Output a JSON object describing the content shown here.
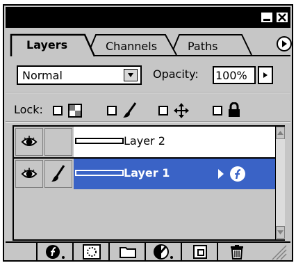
{
  "tabs": [
    {
      "label": "Layers",
      "active": true
    },
    {
      "label": "Channels",
      "active": false
    },
    {
      "label": "Paths",
      "active": false
    }
  ],
  "blend_mode": {
    "selected": "Normal"
  },
  "opacity": {
    "label": "Opacity:",
    "value": "100%"
  },
  "lock": {
    "label": "Lock:",
    "options": [
      {
        "icon": "transparency-icon",
        "checked": false
      },
      {
        "icon": "brush-icon",
        "checked": false
      },
      {
        "icon": "move-icon",
        "checked": false
      },
      {
        "icon": "lock-icon",
        "checked": false
      }
    ]
  },
  "layers": [
    {
      "name": "Layer 2",
      "visible": true,
      "selected": false,
      "has_brush": false
    },
    {
      "name": "Layer 1",
      "visible": true,
      "selected": true,
      "has_brush": true,
      "effects": true
    }
  ],
  "toolbar": {
    "buttons": [
      {
        "icon": "layer-style-icon"
      },
      {
        "icon": "layer-mask-icon"
      },
      {
        "icon": "new-set-icon"
      },
      {
        "icon": "adjustment-layer-icon"
      },
      {
        "icon": "new-layer-icon"
      },
      {
        "icon": "trash-icon"
      }
    ]
  },
  "colors": {
    "selection": "#3a63c6",
    "panel": "#c6c6c6"
  }
}
